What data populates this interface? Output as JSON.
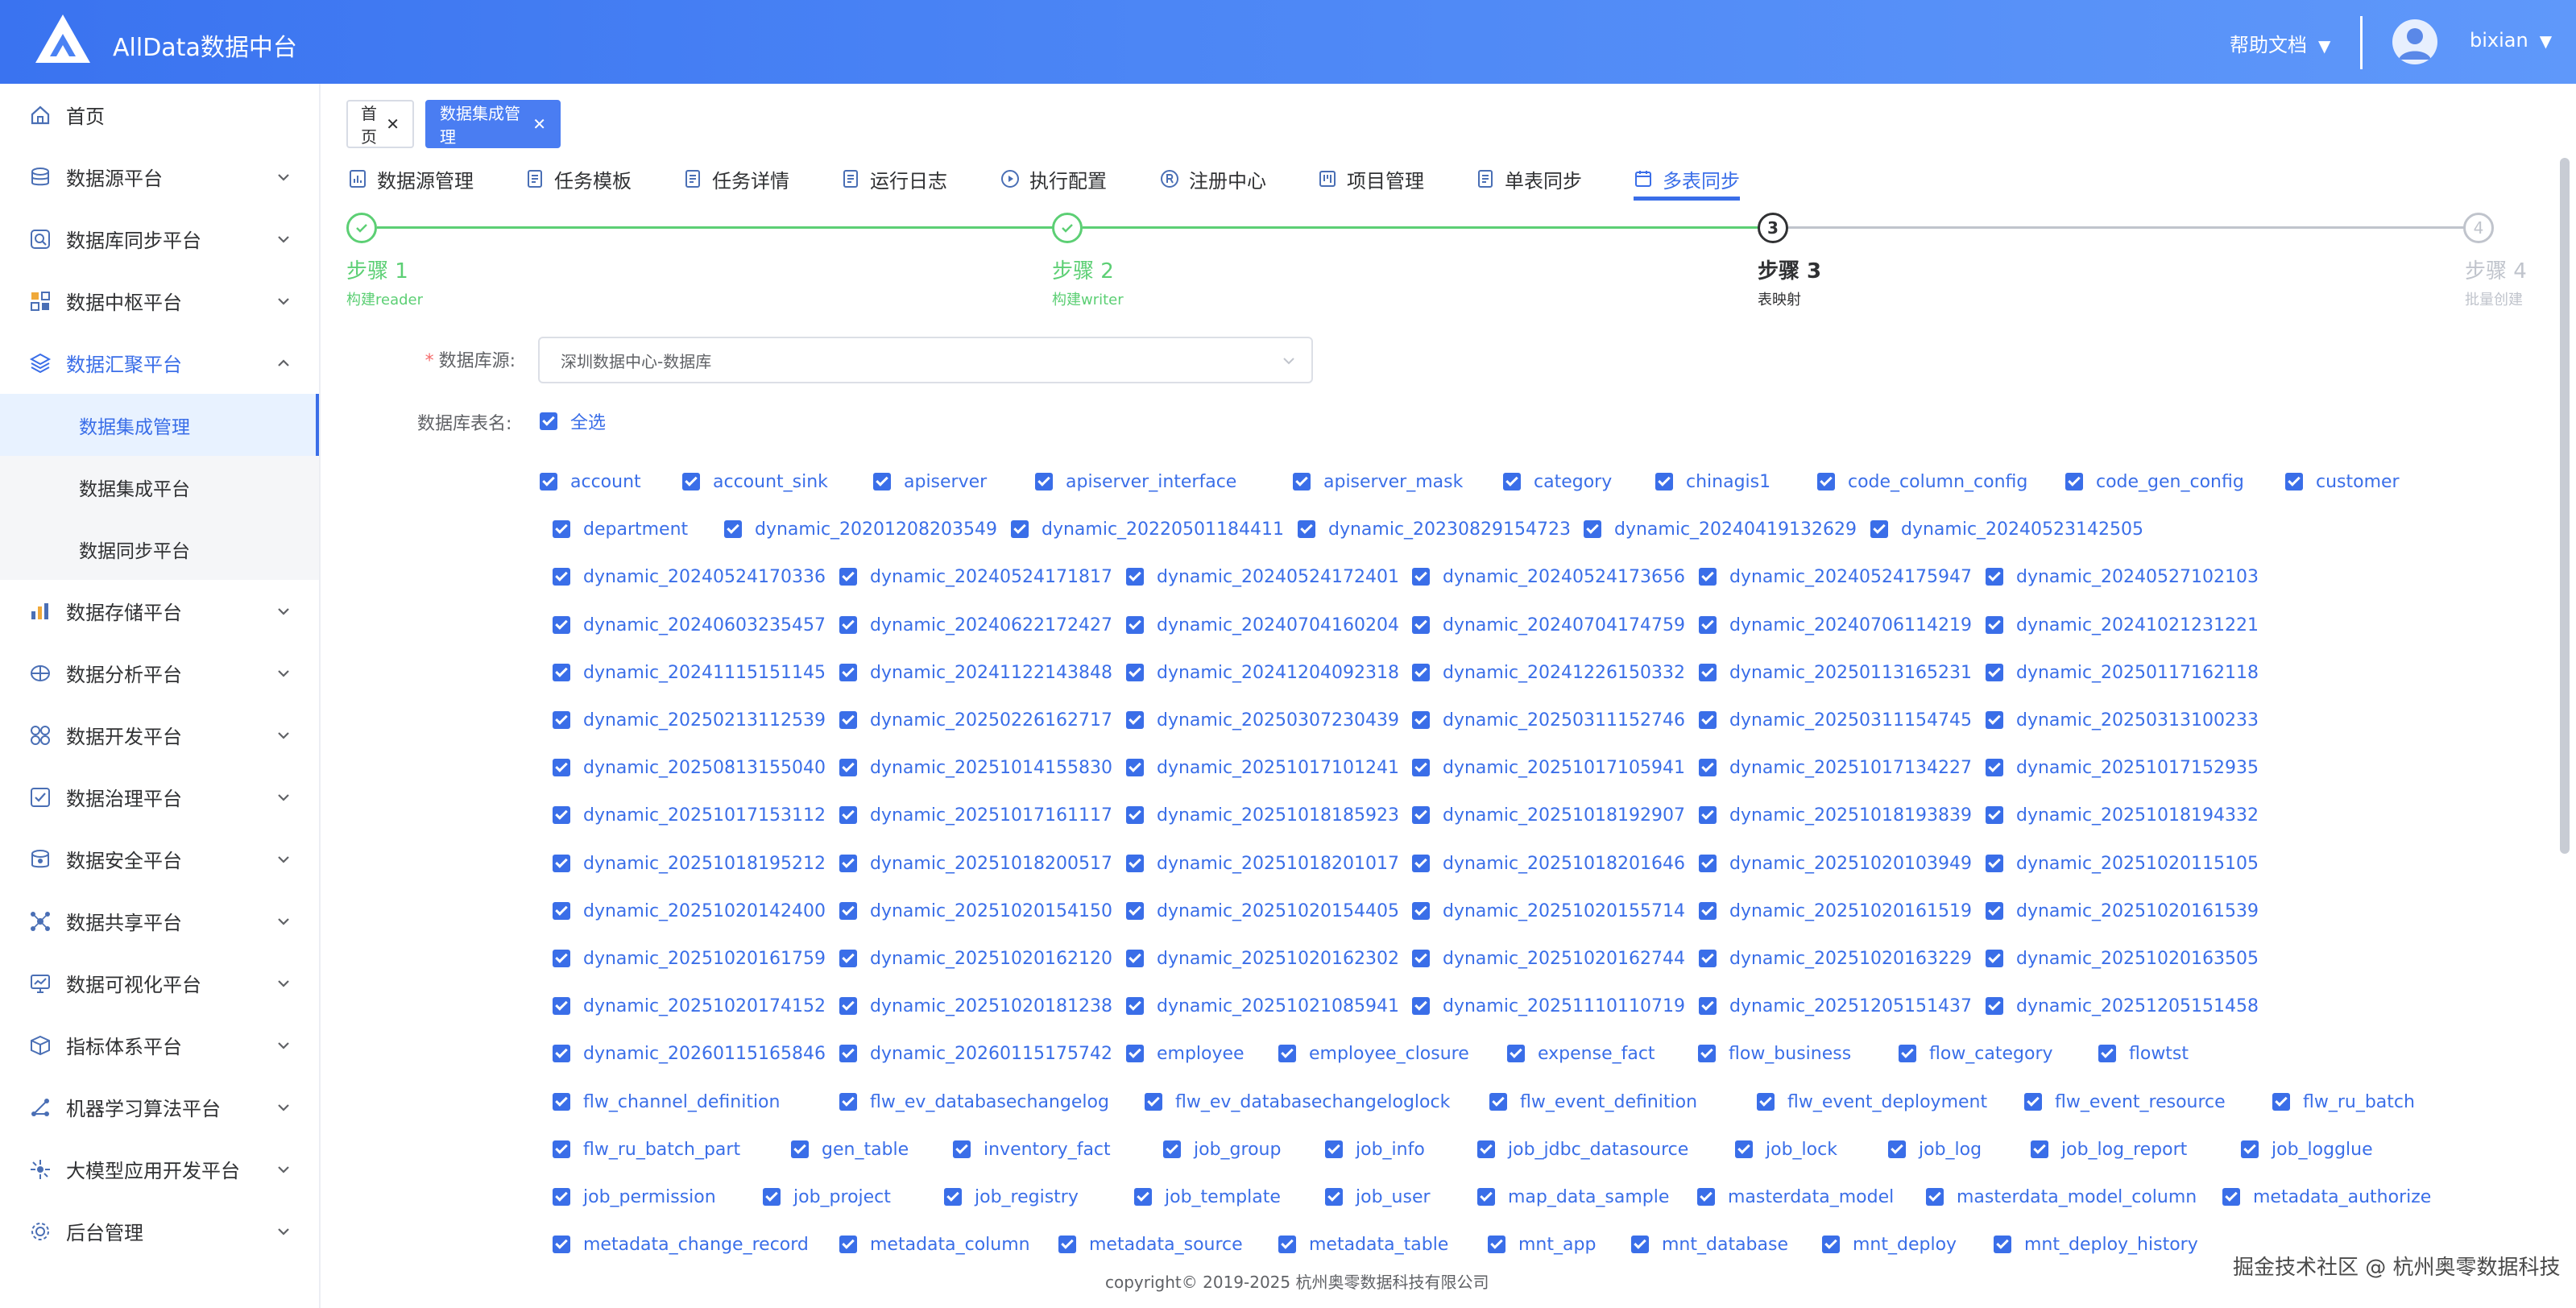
{
  "header": {
    "app_title": "AllData数据中台",
    "help_label": "帮助文档",
    "username": "bixian",
    "caret": "▼"
  },
  "sidebar": {
    "items": [
      {
        "label": "首页",
        "icon": "home-icon"
      },
      {
        "label": "数据源平台",
        "icon": "database-icon"
      },
      {
        "label": "数据库同步平台",
        "icon": "sync-icon"
      },
      {
        "label": "数据中枢平台",
        "icon": "grid-icon"
      },
      {
        "label": "数据汇聚平台",
        "icon": "layers-icon"
      },
      {
        "label": "数据存储平台",
        "icon": "storage-icon"
      },
      {
        "label": "数据分析平台",
        "icon": "analysis-icon"
      },
      {
        "label": "数据开发平台",
        "icon": "dev-icon"
      },
      {
        "label": "数据治理平台",
        "icon": "governance-icon"
      },
      {
        "label": "数据安全平台",
        "icon": "security-icon"
      },
      {
        "label": "数据共享平台",
        "icon": "share-icon"
      },
      {
        "label": "数据可视化平台",
        "icon": "visual-icon"
      },
      {
        "label": "指标体系平台",
        "icon": "cube-icon"
      },
      {
        "label": "机器学习算法平台",
        "icon": "ml-icon"
      },
      {
        "label": "大模型应用开发平台",
        "icon": "llm-icon"
      },
      {
        "label": "后台管理",
        "icon": "settings-icon"
      }
    ],
    "subitems": [
      "数据集成管理",
      "数据集成平台",
      "数据同步平台"
    ]
  },
  "tags": {
    "home": "首页",
    "active": "数据集成管理",
    "close": "✕"
  },
  "topnav": [
    "数据源管理",
    "任务模板",
    "任务详情",
    "运行日志",
    "执行配置",
    "注册中心",
    "项目管理",
    "单表同步",
    "多表同步"
  ],
  "steps": [
    {
      "title": "步骤 1",
      "desc": "构建reader",
      "num": "1"
    },
    {
      "title": "步骤 2",
      "desc": "构建writer",
      "num": "2"
    },
    {
      "title": "步骤 3",
      "desc": "表映射",
      "num": "3"
    },
    {
      "title": "步骤 4",
      "desc": "批量创建",
      "num": "4"
    }
  ],
  "form": {
    "datasource_label": "数据库源:",
    "datasource_value": "深圳数据中心-数据库",
    "table_label": "数据库表名:",
    "select_all": "全选"
  },
  "tables": [
    [
      "account",
      "account_sink",
      "apiserver",
      "apiserver_interface",
      "apiserver_mask",
      "category",
      "chinagis1",
      "code_column_config",
      "code_gen_config",
      "customer"
    ],
    [
      "department",
      "dynamic_20201208203549",
      "dynamic_20220501184411",
      "dynamic_20230829154723",
      "dynamic_20240419132629",
      "dynamic_20240523142505"
    ],
    [
      "dynamic_20240524170336",
      "dynamic_20240524171817",
      "dynamic_20240524172401",
      "dynamic_20240524173656",
      "dynamic_20240524175947",
      "dynamic_20240527102103"
    ],
    [
      "dynamic_20240603235457",
      "dynamic_20240622172427",
      "dynamic_20240704160204",
      "dynamic_20240704174759",
      "dynamic_20240706114219",
      "dynamic_20241021231221"
    ],
    [
      "dynamic_20241115151145",
      "dynamic_20241122143848",
      "dynamic_20241204092318",
      "dynamic_20241226150332",
      "dynamic_20250113165231",
      "dynamic_20250117162118"
    ],
    [
      "dynamic_20250213112539",
      "dynamic_20250226162717",
      "dynamic_20250307230439",
      "dynamic_20250311152746",
      "dynamic_20250311154745",
      "dynamic_20250313100233"
    ],
    [
      "dynamic_20250813155040",
      "dynamic_20251014155830",
      "dynamic_20251017101241",
      "dynamic_20251017105941",
      "dynamic_20251017134227",
      "dynamic_20251017152935"
    ],
    [
      "dynamic_20251017153112",
      "dynamic_20251017161117",
      "dynamic_20251018185923",
      "dynamic_20251018192907",
      "dynamic_20251018193839",
      "dynamic_20251018194332"
    ],
    [
      "dynamic_20251018195212",
      "dynamic_20251018200517",
      "dynamic_20251018201017",
      "dynamic_20251018201646",
      "dynamic_20251020103949",
      "dynamic_20251020115105"
    ],
    [
      "dynamic_20251020142400",
      "dynamic_20251020154150",
      "dynamic_20251020154405",
      "dynamic_20251020155714",
      "dynamic_20251020161519",
      "dynamic_20251020161539"
    ],
    [
      "dynamic_20251020161759",
      "dynamic_20251020162120",
      "dynamic_20251020162302",
      "dynamic_20251020162744",
      "dynamic_20251020163229",
      "dynamic_20251020163505"
    ],
    [
      "dynamic_20251020174152",
      "dynamic_20251020181238",
      "dynamic_20251021085941",
      "dynamic_20251110110719",
      "dynamic_20251205151437",
      "dynamic_20251205151458"
    ],
    [
      "dynamic_20260115165846",
      "dynamic_20260115175742",
      "employee",
      "employee_closure",
      "expense_fact",
      "flow_business",
      "flow_category",
      "flowtst"
    ],
    [
      "flw_channel_definition",
      "flw_ev_databasechangelog",
      "flw_ev_databasechangeloglock",
      "flw_event_definition",
      "flw_event_deployment",
      "flw_event_resource",
      "flw_ru_batch"
    ],
    [
      "flw_ru_batch_part",
      "gen_table",
      "inventory_fact",
      "job_group",
      "job_info",
      "job_jdbc_datasource",
      "job_lock",
      "job_log",
      "job_log_report",
      "job_logglue"
    ],
    [
      "job_permission",
      "job_project",
      "job_registry",
      "job_template",
      "job_user",
      "map_data_sample",
      "masterdata_model",
      "masterdata_model_column",
      "metadata_authorize"
    ],
    [
      "metadata_change_record",
      "metadata_column",
      "metadata_source",
      "metadata_table",
      "mnt_app",
      "mnt_database",
      "mnt_deploy",
      "mnt_deploy_history"
    ]
  ],
  "footer": {
    "copyright": "copyright© 2019-2025 杭州奥零数据科技有限公司",
    "watermark": "掘金技术社区 @ 杭州奥零数据科技"
  },
  "colors": {
    "primary": "#3a6ee8",
    "success": "#5ccf74",
    "header_gradient_start": "#3a73f0",
    "header_gradient_end": "#5f98fa"
  }
}
